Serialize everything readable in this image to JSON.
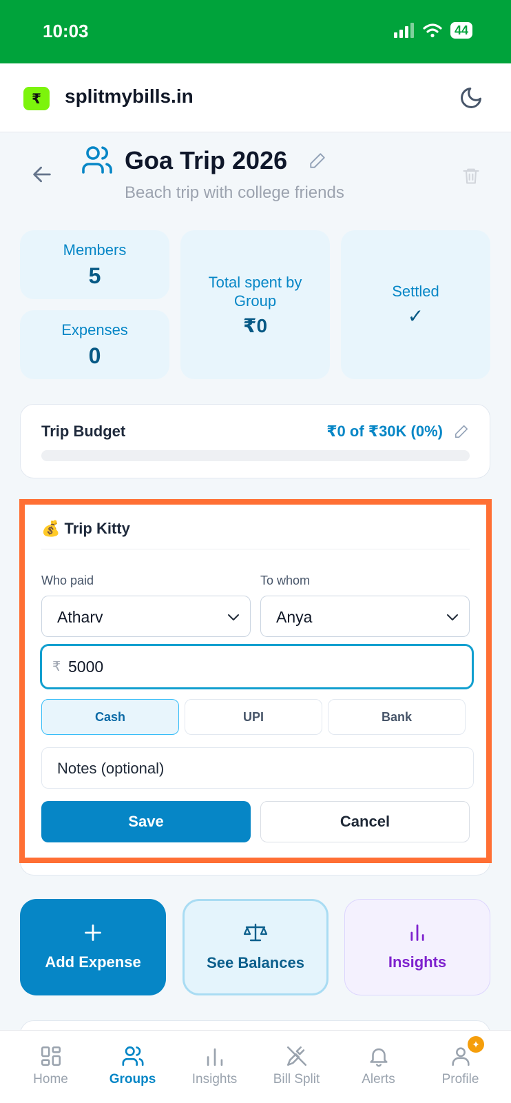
{
  "status_bar": {
    "time": "10:03",
    "battery": "44"
  },
  "header": {
    "logo_symbol": "₹",
    "site_name": "splitmybills.in"
  },
  "group": {
    "title": "Goa Trip 2026",
    "subtitle": "Beach trip with college friends"
  },
  "stats": {
    "members": {
      "label": "Members",
      "value": "5"
    },
    "expenses": {
      "label": "Expenses",
      "value": "0"
    },
    "total_spent": {
      "label": "Total spent by Group",
      "value": "₹0"
    },
    "settled": {
      "label": "Settled",
      "value": "✓"
    }
  },
  "budget": {
    "title": "Trip Budget",
    "summary": "₹0 of ₹30K (0%)",
    "progress_percent": 0
  },
  "kitty": {
    "title": "💰 Trip Kitty",
    "who_paid_label": "Who paid",
    "who_paid_value": "Atharv",
    "to_whom_label": "To whom",
    "to_whom_value": "Anya",
    "currency_symbol": "₹",
    "amount": "5000",
    "methods": [
      "Cash",
      "UPI",
      "Bank"
    ],
    "selected_method": "Cash",
    "notes_placeholder": "Notes (optional)",
    "save_label": "Save",
    "cancel_label": "Cancel"
  },
  "actions": [
    {
      "label": "Add Expense",
      "icon": "plus-icon"
    },
    {
      "label": "See Balances",
      "icon": "scale-icon"
    },
    {
      "label": "Insights",
      "icon": "bar-chart-icon"
    }
  ],
  "nav": {
    "items": [
      {
        "label": "Home",
        "icon": "grid-icon"
      },
      {
        "label": "Groups",
        "icon": "users-icon"
      },
      {
        "label": "Insights",
        "icon": "bar-chart-icon"
      },
      {
        "label": "Bill Split",
        "icon": "utensils-icon"
      },
      {
        "label": "Alerts",
        "icon": "bell-icon"
      },
      {
        "label": "Profile",
        "icon": "user-icon"
      }
    ],
    "active": "Groups"
  },
  "colors": {
    "primary": "#0686c6",
    "status_bar": "#00a33b",
    "highlight_border": "#ff6f34",
    "insights_purple": "#7e22ce"
  }
}
